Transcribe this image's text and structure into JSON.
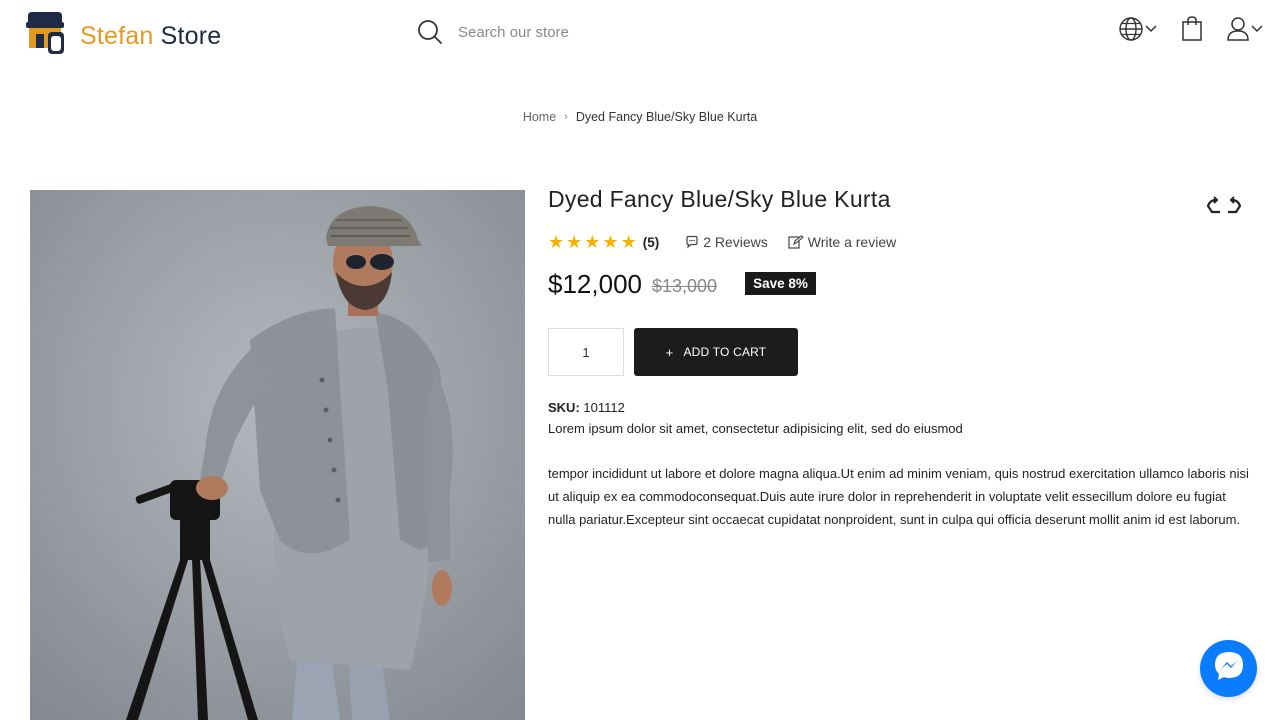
{
  "store": {
    "name_part1": "Stefan",
    "name_part2": "Store"
  },
  "search": {
    "placeholder": "Search our store"
  },
  "header": {
    "icons": [
      "globe-icon",
      "bag-icon",
      "user-icon"
    ]
  },
  "breadcrumb": {
    "home": "Home",
    "separator": "›",
    "current": "Dyed Fancy Blue/Sky Blue Kurta"
  },
  "product": {
    "title": "Dyed Fancy Blue/Sky Blue Kurta",
    "rating": 5,
    "rating_count": "(5)",
    "reviews_label": "2 Reviews",
    "write_review_label": "Write a review",
    "price": "$12,000",
    "compare_price": "$13,000",
    "save_badge": "Save 8%",
    "quantity": "1",
    "add_to_cart_label": "ADD TO CART",
    "add_to_cart_plus": "+",
    "sku_label": "SKU:",
    "sku_value": "101112",
    "description_line1": "Lorem ipsum dolor sit amet, consectetur adipisicing elit, sed do eiusmod",
    "description_para2": "tempor incididunt ut labore et dolore magna aliqua.Ut enim ad minim veniam, quis nostrud exercitation ullamco laboris nisi ut aliquip ex ea commodoconsequat.Duis aute irure dolor in reprehenderit in voluptate velit essecillum dolore eu fugiat nulla pariatur.Excepteur sint occaecat cupidatat nonproident, sunt in culpa qui officia deserunt mollit anim id est laborum."
  },
  "colors": {
    "brand_orange": "#e39a21",
    "brand_navy": "#1f2a44",
    "star": "#f5b301",
    "button_dark": "#1c1c1c",
    "messenger_blue": "#0a7cff"
  }
}
